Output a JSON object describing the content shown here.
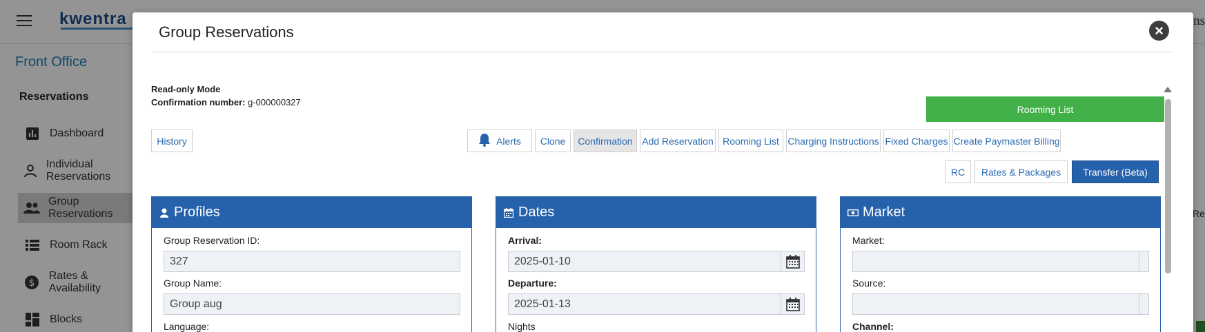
{
  "background": {
    "logo_text": "kwentra",
    "top_right_text": "Ins",
    "right_fragment": "Res",
    "sidebar": {
      "title": "Front Office",
      "section": "Reservations",
      "items": [
        {
          "label": "Dashboard",
          "icon": "chart-icon"
        },
        {
          "label": "Individual Reservations",
          "icon": "person-icon"
        },
        {
          "label": "Group Reservations",
          "icon": "group-icon",
          "active": true
        },
        {
          "label": "Room Rack",
          "icon": "list-icon"
        },
        {
          "label": "Rates & Availability",
          "icon": "dollar-icon"
        },
        {
          "label": "Blocks",
          "icon": "blocks-icon"
        }
      ]
    }
  },
  "modal": {
    "title": "Group Reservations",
    "close_icon": "close-icon",
    "mode_text": "Read-only Mode",
    "confirmation_label": "Confirmation number:",
    "confirmation_value": " g-000000327",
    "buttons": {
      "history": "History",
      "alerts": "Alerts",
      "clone": "Clone",
      "confirmation": "Confirmation",
      "add_reservation": "Add Reservation",
      "rooming_list": "Rooming List",
      "charging_instructions": "Charging Instructions",
      "fixed_charges": "Fixed Charges",
      "create_paymaster_billing": "Create Paymaster Billing",
      "rooming_list_primary": "Rooming List",
      "rc": "RC",
      "rates_packages": "Rates & Packages",
      "transfer_beta": "Transfer (Beta)"
    },
    "colors": {
      "primary_blue": "#2661ab",
      "green": "#41b048",
      "link_blue": "#2c6cb0"
    },
    "panels": {
      "profiles": {
        "title": "Profiles",
        "fields": {
          "group_id_label": "Group Reservation ID:",
          "group_id_value": "327",
          "group_name_label": "Group Name:",
          "group_name_value": "Group aug",
          "language_label": "Language:"
        }
      },
      "dates": {
        "title": "Dates",
        "fields": {
          "arrival_label": "Arrival:",
          "arrival_value": "2025-01-10",
          "departure_label": "Departure:",
          "departure_value": "2025-01-13",
          "nights_label": "Nights"
        }
      },
      "market": {
        "title": "Market",
        "fields": {
          "market_label": "Market:",
          "market_value": "",
          "source_label": "Source:",
          "source_value": "",
          "channel_label": "Channel:"
        }
      }
    }
  }
}
